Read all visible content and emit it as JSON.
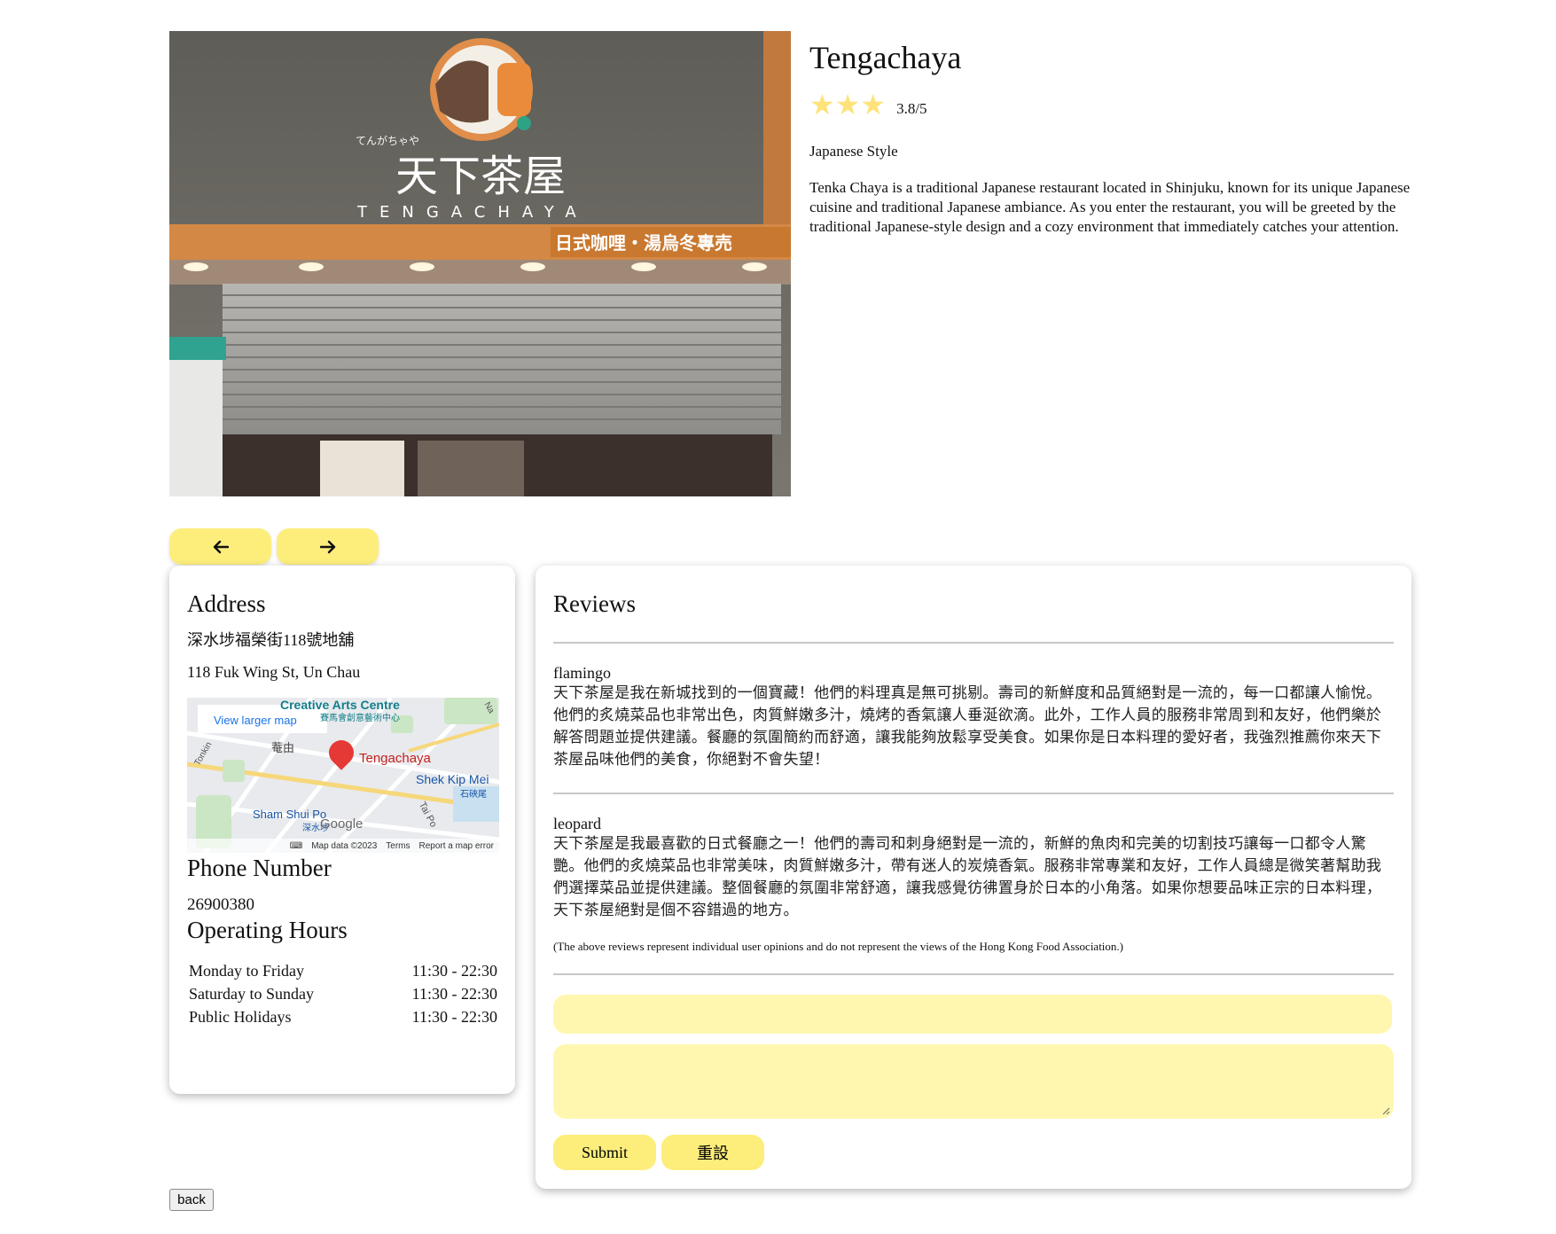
{
  "restaurant": {
    "name": "Tengachaya",
    "stars": "★★★",
    "rating_value": 3.8,
    "rating_text": "3.8/5",
    "style": "Japanese Style",
    "description": "Tenka Chaya is a traditional Japanese restaurant located in Shinjuku, known for its unique Japanese cuisine and traditional Japanese ambiance. As you enter the restaurant, you will be greeted by the traditional Japanese-style design and a cozy environment that immediately catches your attention."
  },
  "photo": {
    "sign_kana": "てんがちゃや",
    "sign_kanji": "天下茶屋",
    "sign_latin": "TENGACHAYA",
    "sign_banner": "日式咖哩・湯烏冬專売"
  },
  "gallery": {
    "prev_icon": "arrow-left-icon",
    "next_icon": "arrow-right-icon"
  },
  "address": {
    "heading": "Address",
    "chinese": "深水埗福榮街118號地舖",
    "english": "118 Fuk Wing St, Un Chau"
  },
  "map": {
    "view_larger": "View larger map",
    "marker_label": "Tengachaya",
    "place_1": "Creative Arts Centre",
    "place_1_zh": "賽馬會創意藝術中心",
    "place_2": "Shek Kip Mei",
    "place_2_zh": "石硤尾",
    "place_3": "Sham Shui Po",
    "place_3_zh": "深水埗",
    "road_1": "Tonkin",
    "road_2": "Tai Po",
    "road_3": "Na",
    "district": "菴由",
    "logo": "Google",
    "map_data": "Map data ©2023",
    "terms": "Terms",
    "report": "Report a map error"
  },
  "phone": {
    "heading": "Phone Number",
    "number": "26900380"
  },
  "hours": {
    "heading": "Operating Hours",
    "rows": [
      {
        "day": "Monday to Friday",
        "time": "11:30 - 22:30"
      },
      {
        "day": "Saturday to Sunday",
        "time": "11:30 - 22:30"
      },
      {
        "day": "Public Holidays",
        "time": "11:30 - 22:30"
      }
    ]
  },
  "reviews": {
    "heading": "Reviews",
    "items": [
      {
        "user": "flamingo",
        "text": "天下茶屋是我在新城找到的一個寶藏！他們的料理真是無可挑剔。壽司的新鮮度和品質絕對是一流的，每一口都讓人愉悅。他們的炙燒菜品也非常出色，肉質鮮嫩多汁，燒烤的香氣讓人垂涎欲滴。此外，工作人員的服務非常周到和友好，他們樂於解答問題並提供建議。餐廳的氛圍簡約而舒適，讓我能夠放鬆享受美食。如果你是日本料理的愛好者，我強烈推薦你來天下茶屋品味他們的美食，你絕對不會失望！"
      },
      {
        "user": "leopard",
        "text": "天下茶屋是我最喜歡的日式餐廳之一！他們的壽司和刺身絕對是一流的，新鮮的魚肉和完美的切割技巧讓每一口都令人驚艷。他們的炙燒菜品也非常美味，肉質鮮嫩多汁，帶有迷人的炭燒香氣。服務非常專業和友好，工作人員總是微笑著幫助我們選擇菜品並提供建議。整個餐廳的氛圍非常舒適，讓我感覺彷彿置身於日本的小角落。如果你想要品味正宗的日本料理，天下茶屋絕對是個不容錯過的地方。"
      }
    ],
    "disclaimer": "(The above reviews represent individual user opinions and do not represent the views of the Hong Kong Food Association.)"
  },
  "form": {
    "name_value": "",
    "comment_value": "",
    "submit_label": "Submit",
    "reset_label": "重設"
  },
  "back_label": "back"
}
